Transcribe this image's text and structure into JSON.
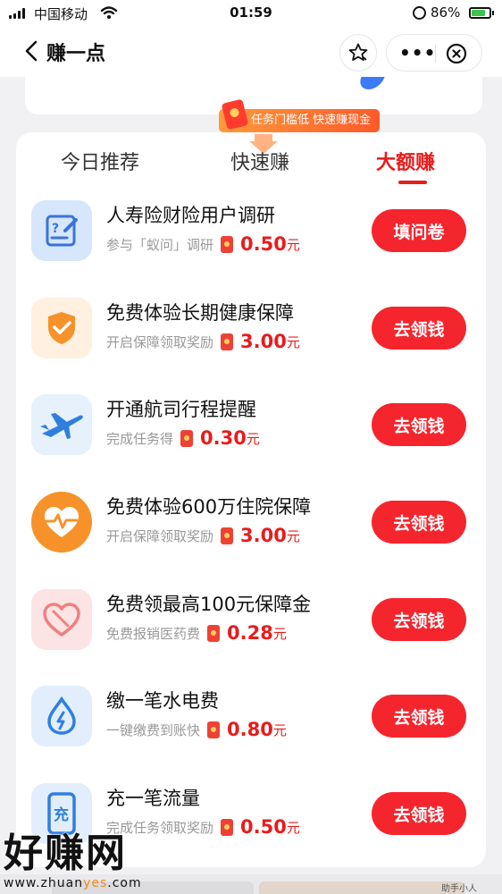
{
  "status_bar": {
    "carrier": "中国移动",
    "time": "01:59",
    "battery_percent": "86%"
  },
  "nav": {
    "title": "赚一点",
    "more_label": "•••"
  },
  "promo_tag": "任务门槛低 快速赚现金",
  "tabs": [
    {
      "label": "今日推荐",
      "active": false
    },
    {
      "label": "快速赚",
      "active": false
    },
    {
      "label": "大额赚",
      "active": true
    }
  ],
  "tasks": [
    {
      "title": "人寿险财险用户调研",
      "desc": "参与「蚁问」调研",
      "amount": "0.50",
      "unit": "元",
      "button": "填问卷",
      "icon": "survey-icon"
    },
    {
      "title": "免费体验长期健康保障",
      "desc": "开启保障领取奖励",
      "amount": "3.00",
      "unit": "元",
      "button": "去领钱",
      "icon": "shield-check-icon"
    },
    {
      "title": "开通航司行程提醒",
      "desc": "完成任务得",
      "amount": "0.30",
      "unit": "元",
      "button": "去领钱",
      "icon": "airplane-icon"
    },
    {
      "title": "免费体验600万住院保障",
      "desc": "开启保障领取奖励",
      "amount": "3.00",
      "unit": "元",
      "button": "去领钱",
      "icon": "heartbeat-icon"
    },
    {
      "title": "免费领最高100元保障金",
      "desc": "免费报销医药费",
      "amount": "0.28",
      "unit": "元",
      "button": "去领钱",
      "icon": "heart-icon"
    },
    {
      "title": "缴一笔水电费",
      "desc": "一键缴费到账快",
      "amount": "0.80",
      "unit": "元",
      "button": "去领钱",
      "icon": "utility-drop-icon"
    },
    {
      "title": "充一笔流量",
      "desc": "完成任务领取奖励",
      "amount": "0.50",
      "unit": "元",
      "button": "去领钱",
      "icon": "phone-topup-icon"
    }
  ],
  "phone_icon_text": "充",
  "watermark": {
    "brand": "好赚网",
    "url_prefix": "www.zhuan",
    "url_accent": "yes",
    "url_suffix": ".com"
  },
  "corner_mark": "助手小人"
}
